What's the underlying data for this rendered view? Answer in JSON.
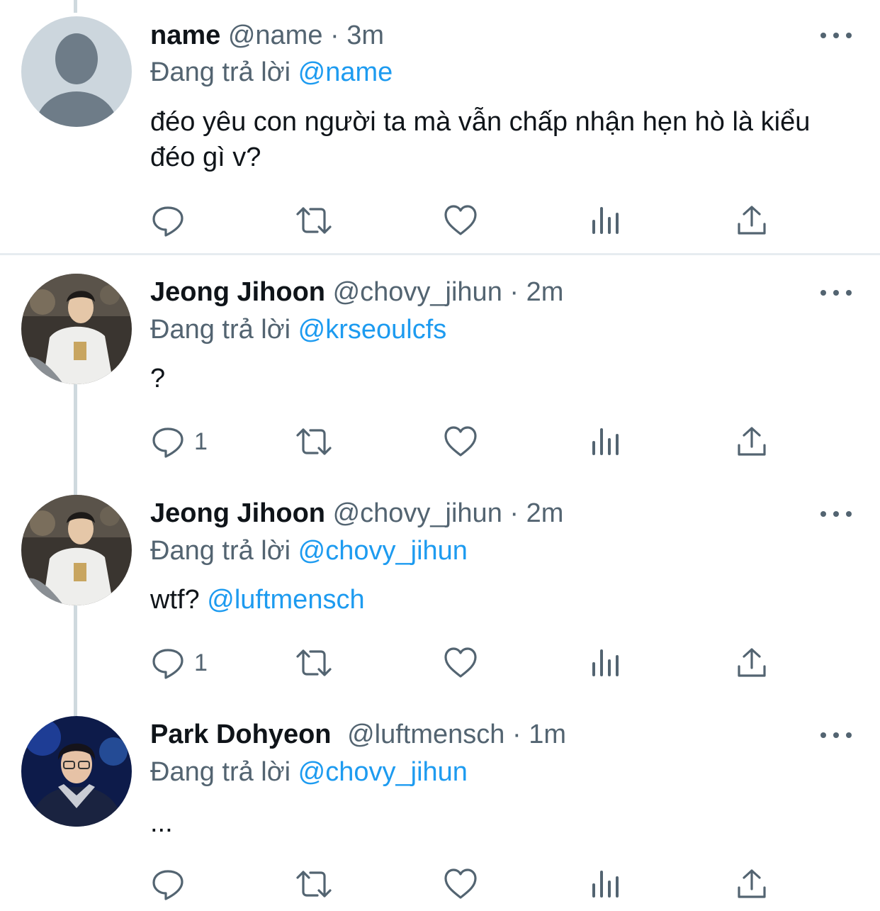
{
  "tweets": [
    {
      "name": "name",
      "handle": "@name",
      "dot": "·",
      "time": "3m",
      "reply_prefix": "Đang trả lời",
      "reply_to": "@name",
      "text": "đéo yêu con người ta mà vẫn chấp nhận hẹn hò là kiểu đéo gì v?",
      "mention": "",
      "reply_count": "",
      "avatar": "default-avatar"
    },
    {
      "name": "Jeong Jihoon",
      "handle": "@chovy_jihun",
      "dot": "·",
      "time": "2m",
      "reply_prefix": "Đang trả lời",
      "reply_to": "@krseoulcfs",
      "text": "?",
      "mention": "",
      "reply_count": "1",
      "avatar": "photo-avatar"
    },
    {
      "name": "Jeong Jihoon",
      "handle": "@chovy_jihun",
      "dot": "·",
      "time": "2m",
      "reply_prefix": "Đang trả lời",
      "reply_to": "@chovy_jihun",
      "text": "wtf?",
      "mention": "@luftmensch",
      "reply_count": "1",
      "avatar": "photo-avatar"
    },
    {
      "name": "Park Dohyeon",
      "handle": "@luftmensch",
      "dot": "·",
      "time": "1m",
      "reply_prefix": "Đang trả lời",
      "reply_to": "@chovy_jihun",
      "text": "...",
      "mention": "",
      "reply_count": "",
      "avatar": "photo-avatar"
    }
  ],
  "colors": {
    "link": "#1d9bf0",
    "secondary_text": "#536471",
    "thread_line": "#cfd9de"
  },
  "icons": [
    "reply-icon",
    "retweet-icon",
    "like-icon",
    "views-icon",
    "share-icon",
    "more-icon"
  ]
}
